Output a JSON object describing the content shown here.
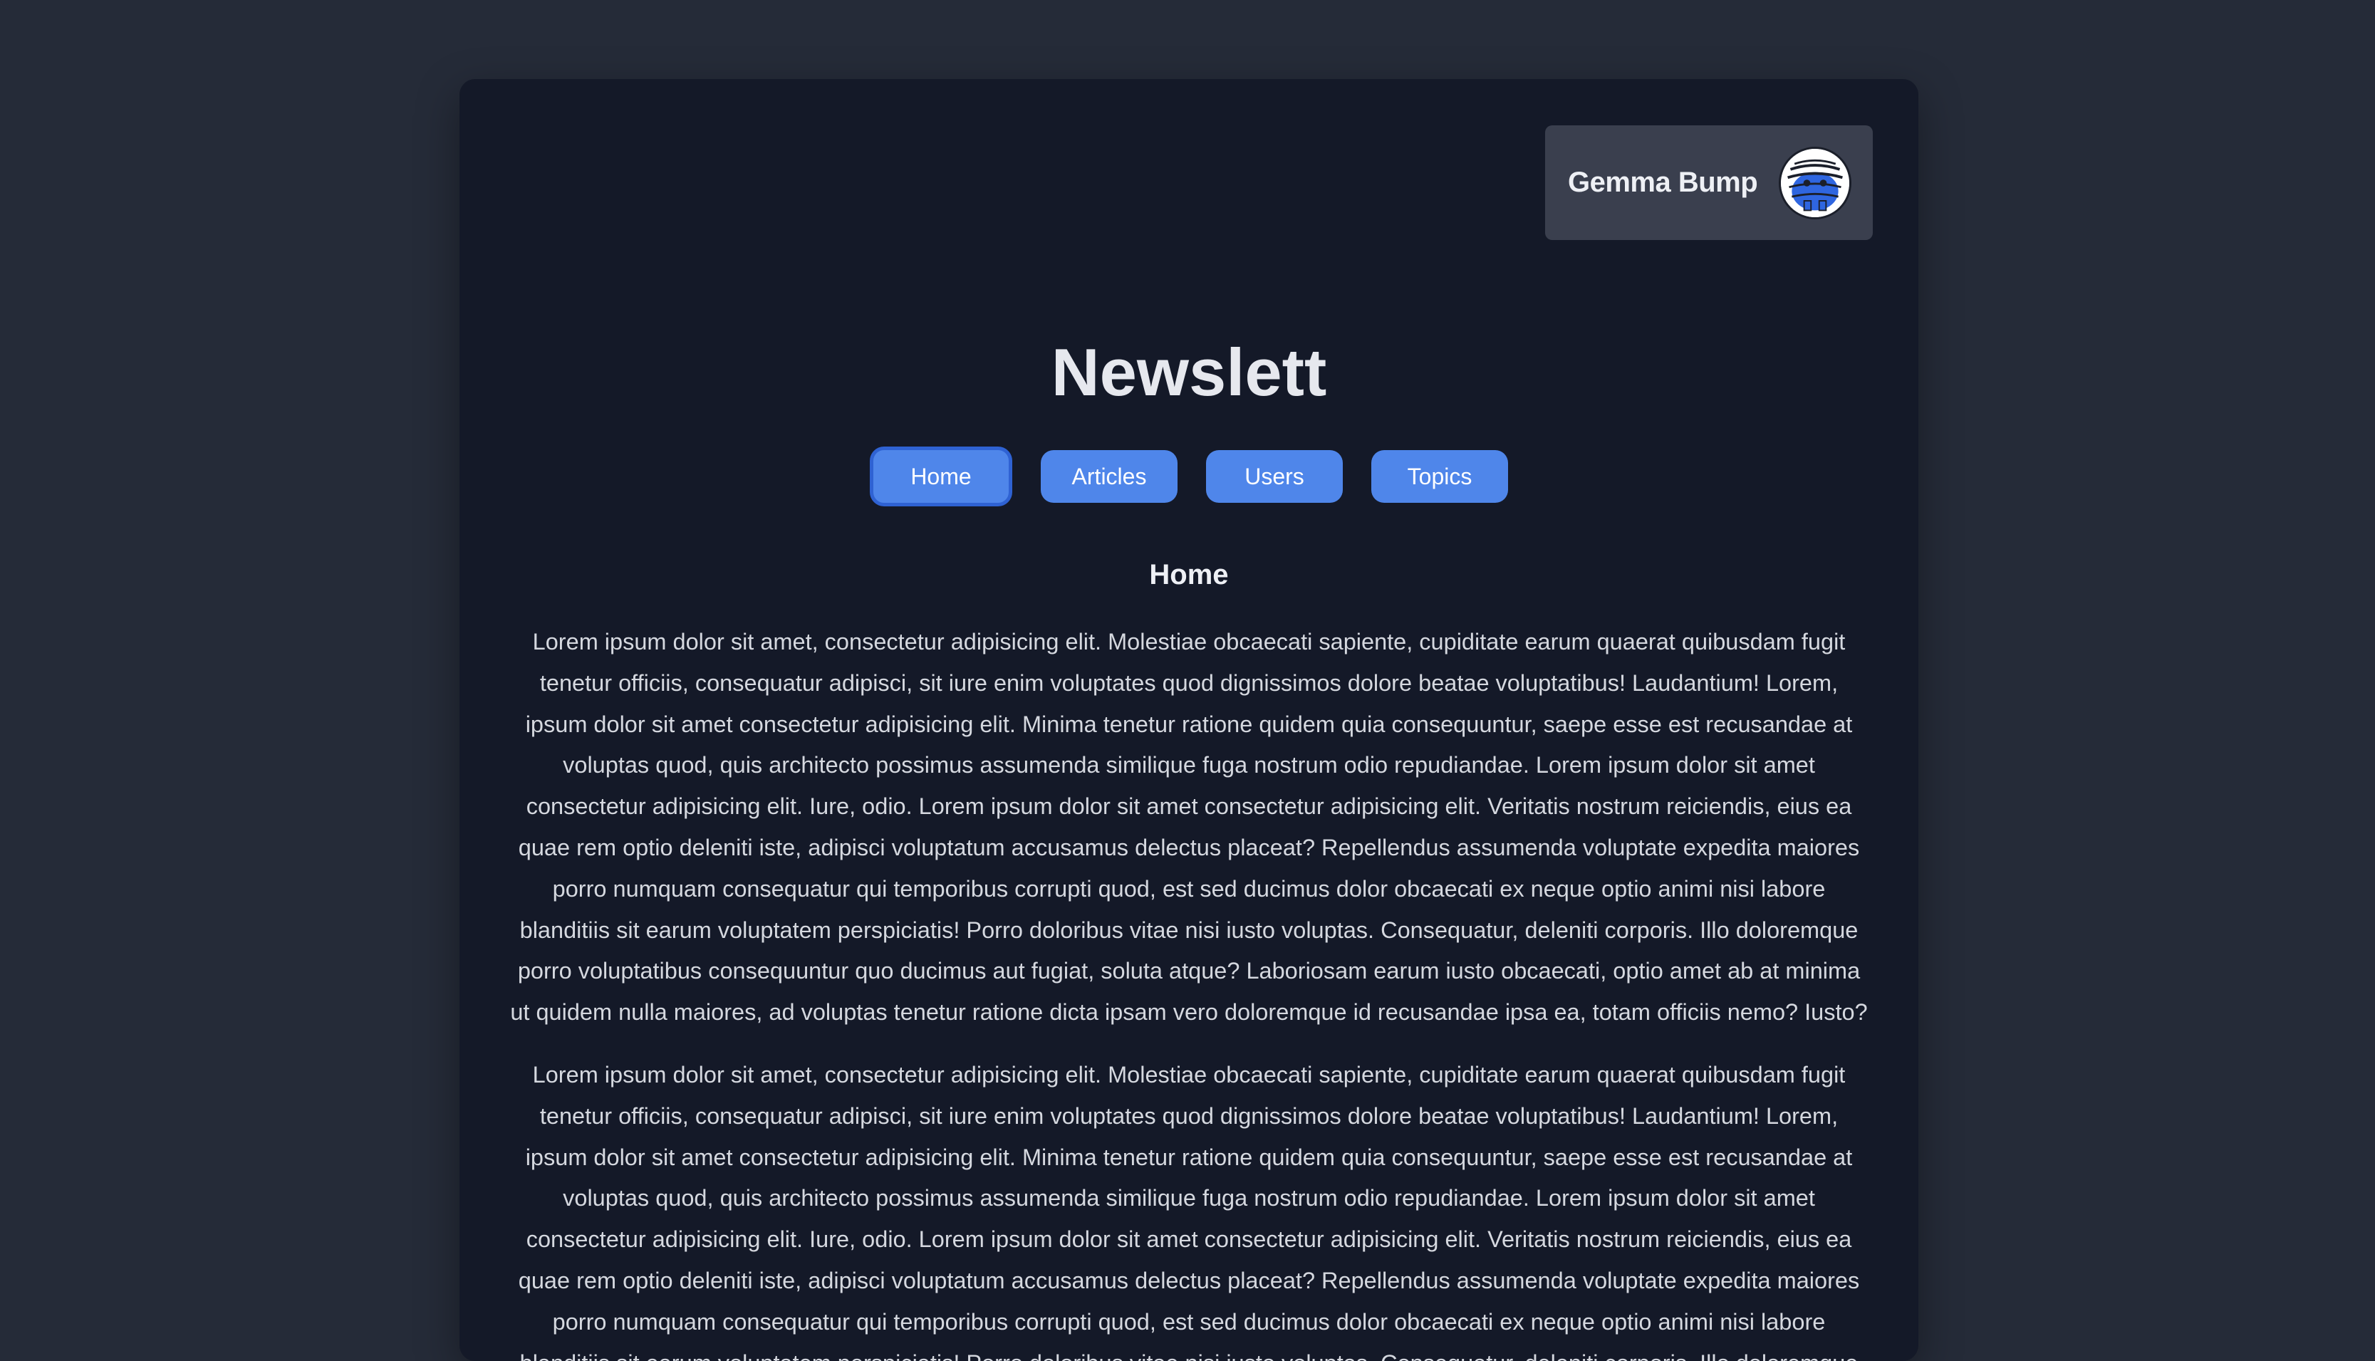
{
  "user": {
    "name": "Gemma Bump",
    "avatar_icon": "mummy-avatar-icon"
  },
  "site": {
    "title": "Newslett"
  },
  "nav": {
    "items": [
      {
        "label": "Home",
        "active": true
      },
      {
        "label": "Articles",
        "active": false
      },
      {
        "label": "Users",
        "active": false
      },
      {
        "label": "Topics",
        "active": false
      }
    ]
  },
  "main": {
    "heading": "Home",
    "paragraphs": [
      "Lorem ipsum dolor sit amet, consectetur adipisicing elit. Molestiae obcaecati sapiente, cupiditate earum quaerat quibusdam fugit tenetur officiis, consequatur adipisci, sit iure enim voluptates quod dignissimos dolore beatae voluptatibus! Laudantium! Lorem, ipsum dolor sit amet consectetur adipisicing elit. Minima tenetur ratione quidem quia consequuntur, saepe esse est recusandae at voluptas quod, quis architecto possimus assumenda similique fuga nostrum odio repudiandae. Lorem ipsum dolor sit amet consectetur adipisicing elit. Iure, odio. Lorem ipsum dolor sit amet consectetur adipisicing elit. Veritatis nostrum reiciendis, eius ea quae rem optio deleniti iste, adipisci voluptatum accusamus delectus placeat? Repellendus assumenda voluptate expedita maiores porro numquam consequatur qui temporibus corrupti quod, est sed ducimus dolor obcaecati ex neque optio animi nisi labore blanditiis sit earum voluptatem perspiciatis! Porro doloribus vitae nisi iusto voluptas. Consequatur, deleniti corporis. Illo doloremque porro voluptatibus consequuntur quo ducimus aut fugiat, soluta atque? Laboriosam earum iusto obcaecati, optio amet ab at minima ut quidem nulla maiores, ad voluptas tenetur ratione dicta ipsam vero doloremque id recusandae ipsa ea, totam officiis nemo? Iusto?",
      "Lorem ipsum dolor sit amet, consectetur adipisicing elit. Molestiae obcaecati sapiente, cupiditate earum quaerat quibusdam fugit tenetur officiis, consequatur adipisci, sit iure enim voluptates quod dignissimos dolore beatae voluptatibus! Laudantium! Lorem, ipsum dolor sit amet consectetur adipisicing elit. Minima tenetur ratione quidem quia consequuntur, saepe esse est recusandae at voluptas quod, quis architecto possimus assumenda similique fuga nostrum odio repudiandae. Lorem ipsum dolor sit amet consectetur adipisicing elit. Iure, odio. Lorem ipsum dolor sit amet consectetur adipisicing elit. Veritatis nostrum reiciendis, eius ea quae rem optio deleniti iste, adipisci voluptatum accusamus delectus placeat? Repellendus assumenda voluptate expedita maiores porro numquam consequatur qui temporibus corrupti quod, est sed ducimus dolor obcaecati ex neque optio animi nisi labore blanditiis sit earum voluptatem perspiciatis! Porro doloribus vitae nisi iusto voluptas. Consequatur, deleniti corporis. Illo doloremque"
    ]
  },
  "colors": {
    "page_bg": "#252b38",
    "card_bg": "#141928",
    "chip_bg": "#3a3f4e",
    "button": "#4f86ea",
    "button_active_border": "#2f62d3",
    "text": "#d5d8df",
    "title": "#e6e8ee"
  }
}
